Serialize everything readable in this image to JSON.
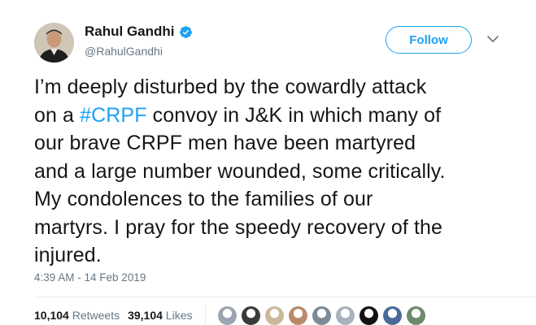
{
  "tweet": {
    "author": {
      "name": "Rahul Gandhi",
      "handle": "@RahulGandhi",
      "avatar_icon": "profile-photo",
      "verified_icon": "verified-badge-icon",
      "verified_color": "#1da1f2"
    },
    "follow_label": "Follow",
    "menu_icon": "chevron-down-icon",
    "text_lines": [
      {
        "before": "I’m deeply disturbed by the cowardly attack",
        "tag": "",
        "after": ""
      },
      {
        "before": "on a ",
        "tag": "#CRPF",
        "after": " convoy in J&K in which many of"
      },
      {
        "before": "our brave CRPF men have been martyred",
        "tag": "",
        "after": ""
      },
      {
        "before": "and a large number wounded, some critically.",
        "tag": "",
        "after": ""
      },
      {
        "before": "My condolences to the families of our",
        "tag": "",
        "after": ""
      },
      {
        "before": "martyrs. I pray for the speedy recovery of the",
        "tag": "",
        "after": ""
      },
      {
        "before": "injured.",
        "tag": "",
        "after": ""
      }
    ],
    "timestamp": "4:39 AM - 14 Feb 2019",
    "stats": {
      "retweets_count": "10,104",
      "retweets_label": "Retweets",
      "likes_count": "39,104",
      "likes_label": "Likes"
    },
    "liker_avatar_colors": [
      "#9aa5b1",
      "#3a3a3a",
      "#c9b99a",
      "#b98a6a",
      "#7d8a96",
      "#a8b3bd",
      "#111111",
      "#4a6a9a",
      "#6f8a6a"
    ]
  },
  "colors": {
    "accent": "#1da1f2",
    "text": "#14171a",
    "muted": "#657786"
  }
}
